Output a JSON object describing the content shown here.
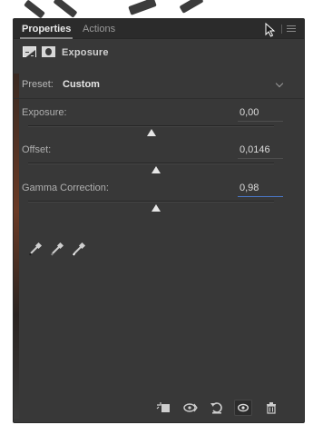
{
  "tabs": [
    {
      "label": "Properties",
      "active": true
    },
    {
      "label": "Actions",
      "active": false
    }
  ],
  "header": {
    "title": "Exposure",
    "icons": [
      "adjustment-icon",
      "mask-icon"
    ]
  },
  "preset": {
    "label": "Preset:",
    "value": "Custom"
  },
  "params": [
    {
      "label": "Exposure:",
      "value": "0,00",
      "slider_fraction": 0.5
    },
    {
      "label": "Offset:",
      "value": "0,0146",
      "slider_fraction": 0.52
    },
    {
      "label": "Gamma Correction:",
      "value": "0,98",
      "slider_fraction": 0.52,
      "focused": true
    }
  ],
  "eyedroppers": [
    "black-point-eyedropper-icon",
    "gray-point-eyedropper-icon",
    "white-point-eyedropper-icon"
  ],
  "bottom_bar": [
    "clip-to-layer-icon",
    "view-previous-state-icon",
    "reset-icon",
    "visibility-eye-icon",
    "delete-icon"
  ],
  "colors": {
    "panel_bg": "#383838",
    "tabbar_bg": "#2b2b2b",
    "focus_underline": "#4a78c8"
  }
}
